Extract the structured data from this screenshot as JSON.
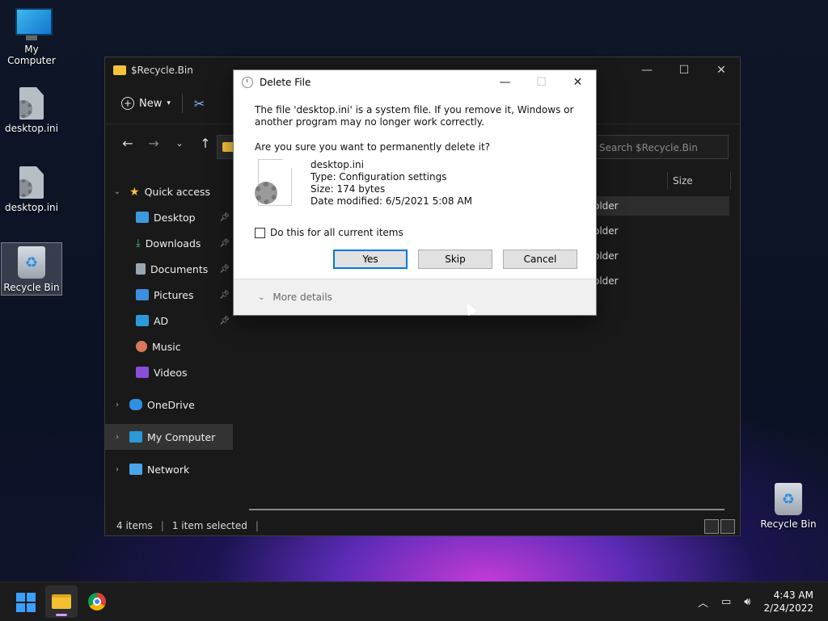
{
  "desktop": {
    "icons": [
      {
        "label": "My Computer"
      },
      {
        "label": "desktop.ini"
      },
      {
        "label": "desktop.ini"
      },
      {
        "label": "Recycle Bin"
      },
      {
        "label": "Recycle Bin"
      }
    ]
  },
  "explorer": {
    "title": "$Recycle.Bin",
    "toolbar": {
      "new_label": "New"
    },
    "search_placeholder": "Search $Recycle.Bin",
    "column_size": "Size",
    "row_fragments": [
      "older",
      "older",
      "older",
      "older"
    ],
    "sidebar": {
      "quick_access": "Quick access",
      "items": [
        {
          "label": "Desktop",
          "pinned": true
        },
        {
          "label": "Downloads",
          "pinned": true
        },
        {
          "label": "Documents",
          "pinned": true
        },
        {
          "label": "Pictures",
          "pinned": true
        },
        {
          "label": "AD",
          "pinned": true
        },
        {
          "label": "Music",
          "pinned": false
        },
        {
          "label": "Videos",
          "pinned": false
        }
      ],
      "onedrive": "OneDrive",
      "my_computer": "My Computer",
      "network": "Network"
    },
    "status": {
      "items": "4 items",
      "selected": "1 item selected"
    }
  },
  "dialog": {
    "title": "Delete File",
    "message": "The file 'desktop.ini' is a system file. If you remove it, Windows or another program may no longer work correctly.",
    "question": "Are you sure you want to permanently delete it?",
    "file": {
      "name": "desktop.ini",
      "type": "Type: Configuration settings",
      "size": "Size: 174 bytes",
      "modified": "Date modified: 6/5/2021 5:08 AM"
    },
    "checkbox_label": "Do this for all current items",
    "buttons": {
      "yes": "Yes",
      "skip": "Skip",
      "cancel": "Cancel"
    },
    "more_details": "More details"
  },
  "taskbar": {
    "time": "4:43 AM",
    "date": "2/24/2022"
  },
  "colors": {
    "accent": "#0078d7",
    "folder": "#f5c33b"
  }
}
